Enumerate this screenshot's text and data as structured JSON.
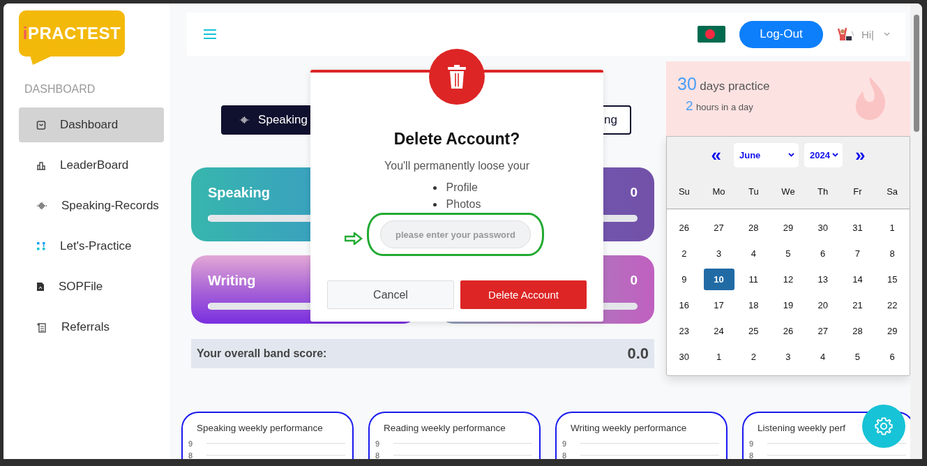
{
  "logo": {
    "prefix": "i",
    "name": "PRACTEST"
  },
  "sidebar": {
    "section": "DASHBOARD",
    "items": [
      {
        "label": "Dashboard",
        "selected": true
      },
      {
        "label": "LeaderBoard",
        "selected": false
      },
      {
        "label": "Speaking-Records",
        "selected": false
      },
      {
        "label": "Let's-Practice",
        "selected": false
      },
      {
        "label": "SOPFile",
        "selected": false
      },
      {
        "label": "Referrals",
        "selected": false
      }
    ]
  },
  "header": {
    "logout": "Log-Out",
    "greeting": "Hi|"
  },
  "tabs": [
    {
      "label": "Speaking",
      "selected": true
    },
    {
      "label": "ng",
      "selected": false
    }
  ],
  "skill_cards": [
    {
      "title": "Speaking",
      "level": 0
    },
    {
      "value": "0",
      "level": 0
    },
    {
      "title": "Writing",
      "level": 0
    },
    {
      "value": "0",
      "level": 0
    }
  ],
  "band_score": {
    "label": "Your overall band score:",
    "value": "0.0"
  },
  "practice": {
    "days": "30",
    "days_label": "days practice",
    "hours": "2",
    "hours_label": "hours in a day"
  },
  "calendar": {
    "prev": "«",
    "next": "»",
    "month": "June",
    "year": "2024",
    "weekdays": [
      "Su",
      "Mo",
      "Tu",
      "We",
      "Th",
      "Fr",
      "Sa"
    ],
    "weeks": [
      [
        {
          "day": "26",
          "selected": false
        },
        {
          "day": "27",
          "selected": false
        },
        {
          "day": "28",
          "selected": false
        },
        {
          "day": "29",
          "selected": false
        },
        {
          "day": "30",
          "selected": false
        },
        {
          "day": "31",
          "selected": false
        },
        {
          "day": "1",
          "selected": false
        }
      ],
      [
        {
          "day": "2",
          "selected": false
        },
        {
          "day": "3",
          "selected": false
        },
        {
          "day": "4",
          "selected": false
        },
        {
          "day": "5",
          "selected": false
        },
        {
          "day": "6",
          "selected": false
        },
        {
          "day": "7",
          "selected": false
        },
        {
          "day": "8",
          "selected": false
        }
      ],
      [
        {
          "day": "9",
          "selected": false
        },
        {
          "day": "10",
          "selected": true
        },
        {
          "day": "11",
          "selected": false
        },
        {
          "day": "12",
          "selected": false
        },
        {
          "day": "13",
          "selected": false
        },
        {
          "day": "14",
          "selected": false
        },
        {
          "day": "15",
          "selected": false
        }
      ],
      [
        {
          "day": "16",
          "selected": false
        },
        {
          "day": "17",
          "selected": false
        },
        {
          "day": "18",
          "selected": false
        },
        {
          "day": "19",
          "selected": false
        },
        {
          "day": "20",
          "selected": false
        },
        {
          "day": "21",
          "selected": false
        },
        {
          "day": "22",
          "selected": false
        }
      ],
      [
        {
          "day": "23",
          "selected": false
        },
        {
          "day": "24",
          "selected": false
        },
        {
          "day": "25",
          "selected": false
        },
        {
          "day": "26",
          "selected": false
        },
        {
          "day": "27",
          "selected": false
        },
        {
          "day": "28",
          "selected": false
        },
        {
          "day": "29",
          "selected": false
        }
      ],
      [
        {
          "day": "30",
          "selected": false
        },
        {
          "day": "1",
          "selected": false
        },
        {
          "day": "2",
          "selected": false
        },
        {
          "day": "3",
          "selected": false
        },
        {
          "day": "4",
          "selected": false
        },
        {
          "day": "5",
          "selected": false
        },
        {
          "day": "6",
          "selected": false
        }
      ]
    ]
  },
  "weekly": [
    {
      "title": "Speaking weekly performance",
      "yticks": [
        "9",
        "8"
      ]
    },
    {
      "title": "Reading weekly performance",
      "yticks": [
        "9",
        "8"
      ]
    },
    {
      "title": "Writing weekly performance",
      "yticks": [
        "9",
        "8"
      ]
    },
    {
      "title": "Listening weekly perf",
      "yticks": [
        "9",
        "8"
      ]
    }
  ],
  "dialog": {
    "title": "Delete Account?",
    "message": "You'll permanently loose your",
    "items": [
      "Profile",
      "Photos"
    ],
    "password_placeholder": "please enter your password",
    "cancel": "Cancel",
    "confirm": "Delete Account"
  }
}
